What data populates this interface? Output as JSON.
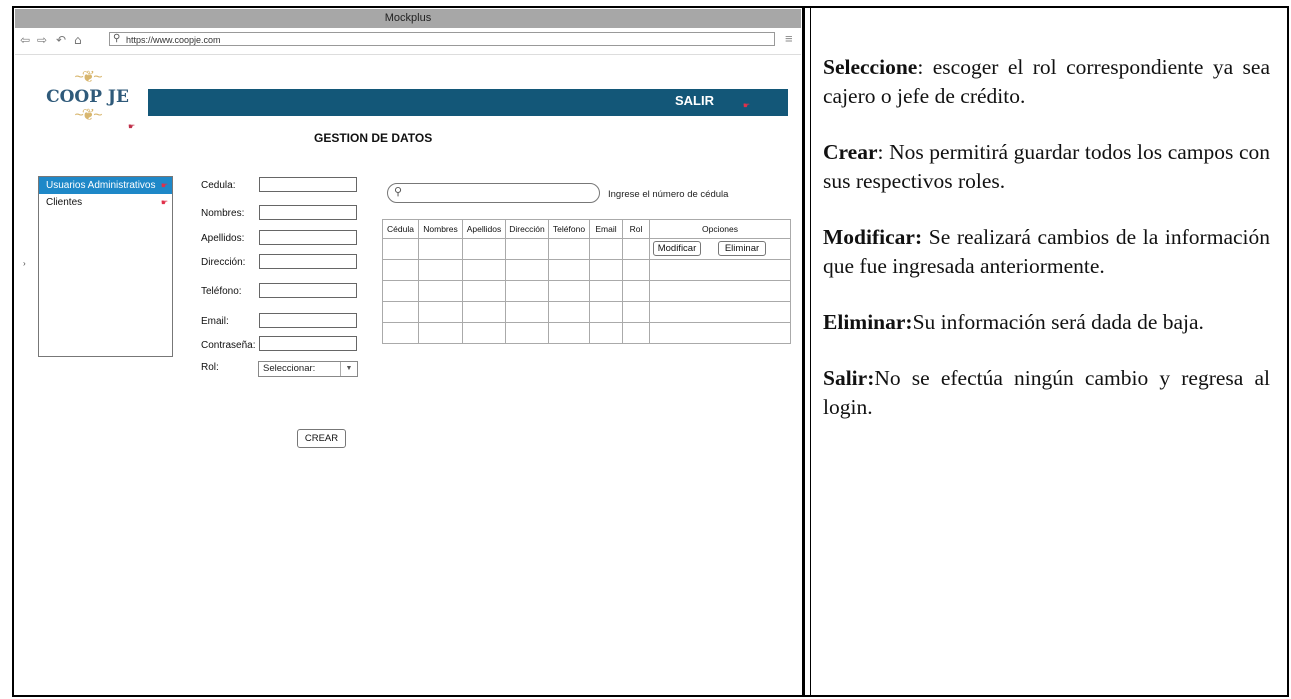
{
  "browser": {
    "app_title": "Mockplus",
    "url": "https://www.coopje.com"
  },
  "logo": {
    "text": "COOP JE"
  },
  "header": {
    "logout_label": "SALIR"
  },
  "page_title": "GESTION DE DATOS",
  "sidebar": {
    "items": [
      {
        "label": "Usuarios Administrativos",
        "active": true
      },
      {
        "label": "Clientes",
        "active": false
      }
    ]
  },
  "form": {
    "labels": {
      "cedula": "Cedula:",
      "nombres": "Nombres:",
      "apellidos": "Apellidos:",
      "direccion": "Dirección:",
      "telefono": "Teléfono:",
      "email": "Email:",
      "contrasena": "Contraseña:",
      "rol": "Rol:"
    },
    "rol_selected": "Seleccionar:",
    "create_label": "CREAR"
  },
  "search": {
    "hint": "Ingrese el número de cédula"
  },
  "table": {
    "columns": [
      "Cédula",
      "Nombres",
      "Apellidos",
      "Dirección",
      "Teléfono",
      "Email",
      "Rol",
      "Opciones"
    ],
    "modify_label": "Modificar",
    "delete_label": "Eliminar"
  },
  "explanations": [
    {
      "term": "Seleccione",
      "sep": ":",
      "text": " escoger el rol correspondiente ya sea cajero o jefe de crédito."
    },
    {
      "term": "Crear",
      "sep": ":",
      "text": " Nos permitirá guardar todos los campos con sus respectivos roles."
    },
    {
      "term": "Modificar:",
      "sep": "",
      "text": " Se realizará cambios de la información que fue ingresada anteriormente."
    },
    {
      "term": "Eliminar:",
      "sep": "",
      "text": "Su información será dada de baja."
    },
    {
      "term": "Salir:",
      "sep": "",
      "text": "No se efectúa ningún cambio y regresa al login."
    }
  ],
  "colors": {
    "header_bar": "#135778",
    "active_item": "#1e88c8",
    "logo_text": "#2f5a7a"
  }
}
